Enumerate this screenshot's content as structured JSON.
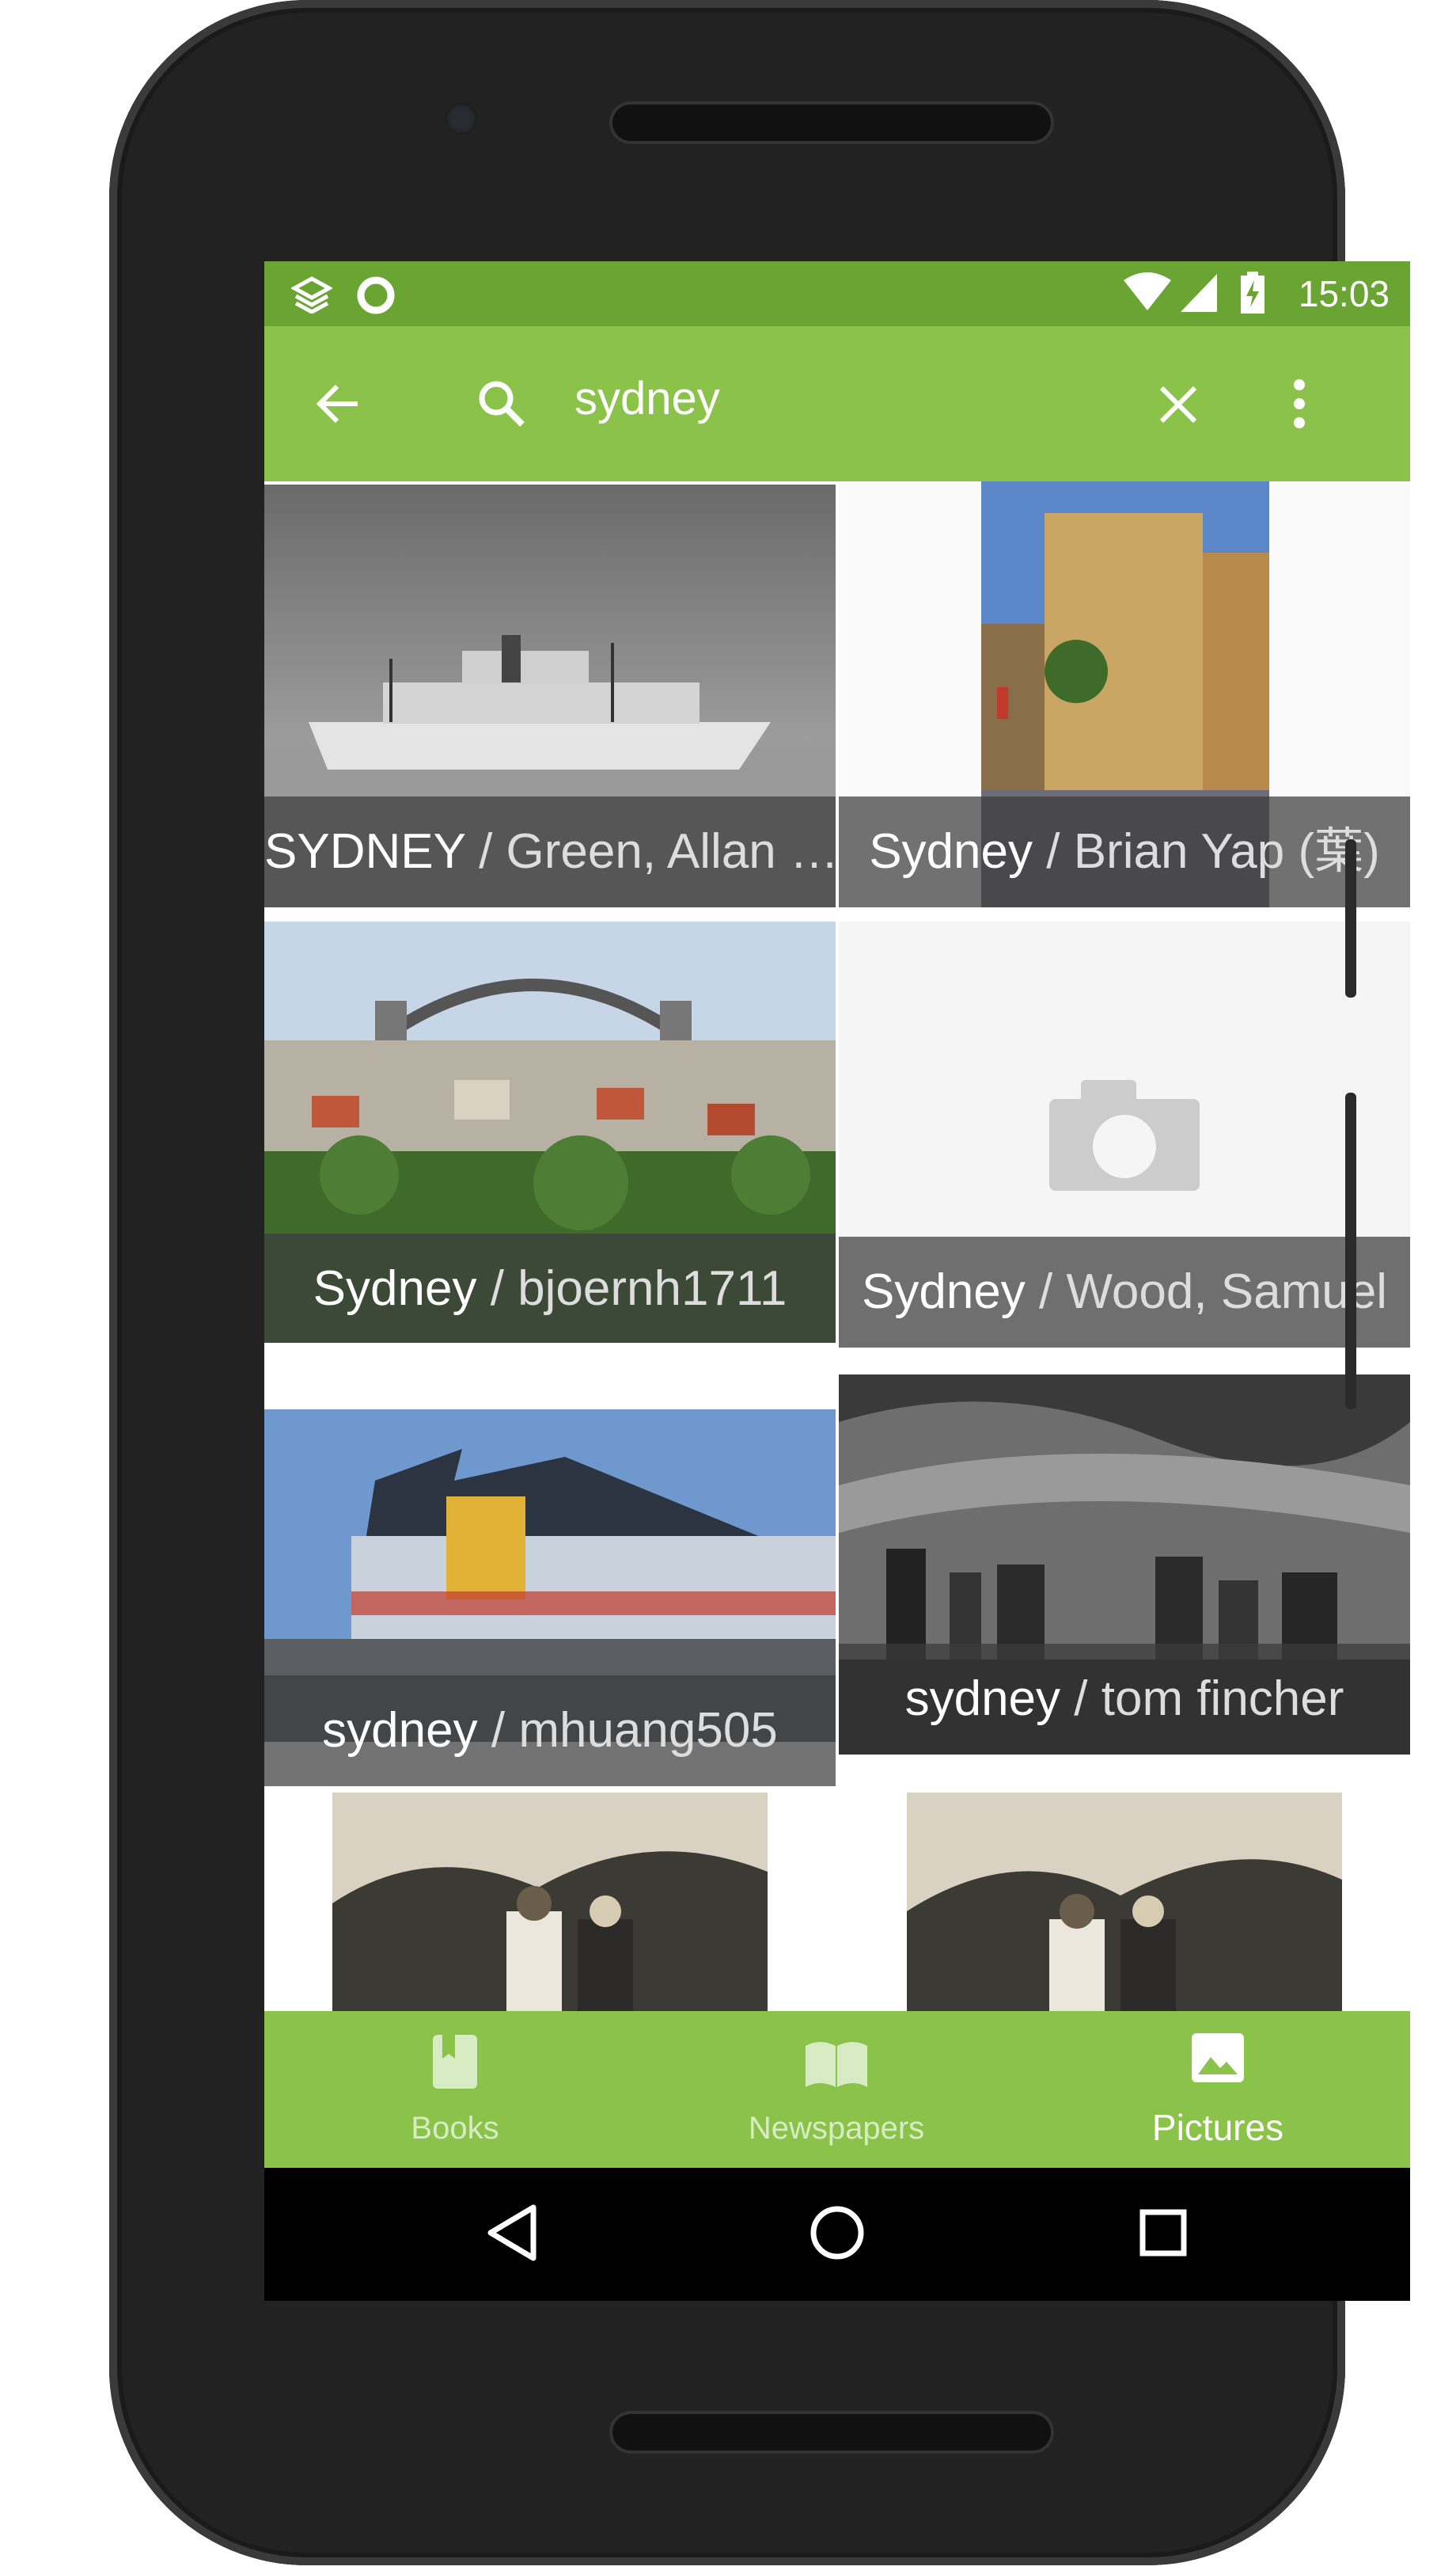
{
  "status_bar": {
    "time": "15:03",
    "icons": [
      "layers-notification-icon",
      "circle-notification-icon",
      "wifi-icon",
      "signal-icon",
      "battery-charging-icon"
    ]
  },
  "app_bar": {
    "back_icon": "arrow-back-icon",
    "search_icon": "search-icon",
    "query": "sydney",
    "clear_icon": "close-icon",
    "menu_icon": "more-vert-icon"
  },
  "results": [
    {
      "title": "SYDNEY",
      "separator": " / ",
      "author": "Green, Allan …",
      "image": "black-and-white ocean liner"
    },
    {
      "title": "Sydney",
      "separator": " / ",
      "author": "Brian Yap (葉)",
      "image": "city street with tall buildings"
    },
    {
      "title": "Sydney",
      "separator": " / ",
      "author": "bjoernh1711",
      "image": "harbour bridge over suburbs"
    },
    {
      "title": "Sydney",
      "separator": " / ",
      "author": "Wood, Samuel",
      "image": "placeholder camera-icon"
    },
    {
      "title": "sydney",
      "separator": " / ",
      "author": "mhuang505",
      "image": "modern building by the water"
    },
    {
      "title": "sydney",
      "separator": " / ",
      "author": "tom fincher",
      "image": "black-and-white city skyline"
    },
    {
      "title": "",
      "separator": "",
      "author": "",
      "image": "sepia photo of two people"
    },
    {
      "title": "",
      "separator": "",
      "author": "",
      "image": "sepia photo of two people"
    }
  ],
  "bottom_nav": {
    "items": [
      {
        "label": "Books",
        "icon": "book-icon",
        "active": false
      },
      {
        "label": "Newspapers",
        "icon": "open-book-icon",
        "active": false
      },
      {
        "label": "Pictures",
        "icon": "image-icon",
        "active": true
      }
    ]
  },
  "system_nav": {
    "back_icon": "triangle-back-icon",
    "home_icon": "circle-home-icon",
    "recents_icon": "square-recents-icon"
  },
  "colors": {
    "primary": "#8bc34a",
    "primary_dark": "#6aa432",
    "caption_overlay": "#3c3c3c"
  }
}
